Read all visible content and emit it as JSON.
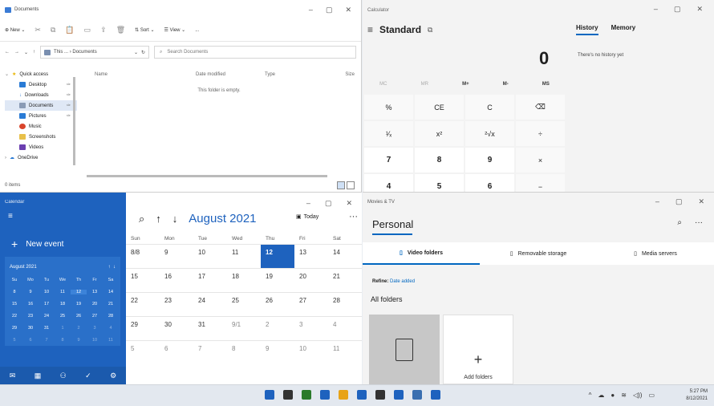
{
  "explorer": {
    "title": "Documents",
    "cmd": {
      "new": "New",
      "sort": "Sort",
      "view": "View",
      "more": "..."
    },
    "path": "This ... › Documents",
    "search_placeholder": "Search Documents",
    "nav": [
      "Quick access",
      "Desktop",
      "Downloads",
      "Documents",
      "Pictures",
      "Music",
      "Screenshots",
      "Videos",
      "OneDrive"
    ],
    "columns": [
      "Name",
      "Date modified",
      "Type",
      "Size"
    ],
    "empty": "This folder is empty.",
    "status": "0 items"
  },
  "calculator": {
    "title": "Calculator",
    "mode": "Standard",
    "display": "0",
    "tabs": [
      "History",
      "Memory"
    ],
    "history_empty": "There's no history yet",
    "memory": [
      "MC",
      "MR",
      "M+",
      "M-",
      "MS"
    ],
    "keys": [
      "%",
      "CE",
      "C",
      "⌫",
      "¹⁄ₓ",
      "x²",
      "²√x",
      "÷",
      "7",
      "8",
      "9",
      "×",
      "4",
      "5",
      "6",
      "−"
    ]
  },
  "calendar": {
    "title": "Calendar",
    "new_event": "New event",
    "mini_month": "August 2021",
    "mini_dow": [
      "Su",
      "Mo",
      "Tu",
      "We",
      "Th",
      "Fr",
      "Sa"
    ],
    "mini_days": [
      "8",
      "9",
      "10",
      "11",
      "12",
      "13",
      "14",
      "15",
      "16",
      "17",
      "18",
      "19",
      "20",
      "21",
      "22",
      "23",
      "24",
      "25",
      "26",
      "27",
      "28",
      "29",
      "30",
      "31",
      "1",
      "2",
      "3",
      "4",
      "5",
      "6",
      "7",
      "8",
      "9",
      "10",
      "11"
    ],
    "month": "August 2021",
    "today": "Today",
    "dow": [
      "Sun",
      "Mon",
      "Tue",
      "Wed",
      "Thu",
      "Fri",
      "Sat"
    ],
    "days": [
      "8/8",
      "9",
      "10",
      "11",
      "12",
      "13",
      "14",
      "15",
      "16",
      "17",
      "18",
      "19",
      "20",
      "21",
      "22",
      "23",
      "24",
      "25",
      "26",
      "27",
      "28",
      "29",
      "30",
      "31",
      "9/1",
      "2",
      "3",
      "4",
      "5",
      "6",
      "7",
      "8",
      "9",
      "10",
      "11"
    ]
  },
  "movies": {
    "title": "Movies & TV",
    "heading": "Personal",
    "tabs": [
      "Video folders",
      "Removable storage",
      "Media servers"
    ],
    "refine_label": "Refine:",
    "refine_value": "Date added",
    "section": "All folders",
    "add": "Add folders"
  },
  "taskbar": {
    "time": "5:27 PM",
    "date": "8/12/2021",
    "app_colors": [
      "#1e62be",
      "#333333",
      "#2a7a2a",
      "#1e62be",
      "#e8a317",
      "#1e62be",
      "#333333",
      "#1e62be",
      "#3a6fb0",
      "#1e62be"
    ]
  }
}
